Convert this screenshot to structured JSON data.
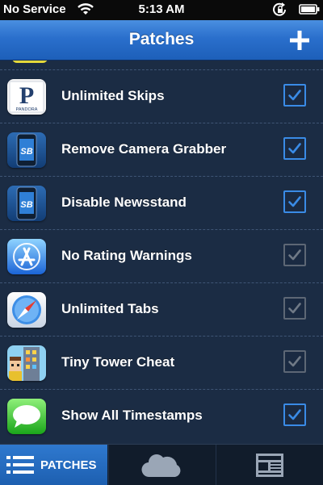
{
  "status_bar": {
    "carrier": "No Service",
    "time": "5:13 AM"
  },
  "nav": {
    "title": "Patches",
    "add_icon": "plus-icon"
  },
  "patches": [
    {
      "label": "Unlimited Skips",
      "icon": "pandora-app-icon",
      "icon_text": "P",
      "icon_subtext": "PANDORA",
      "checked": true
    },
    {
      "label": "Remove Camera Grabber",
      "icon": "springboard-app-icon",
      "icon_text": "SB",
      "checked": true
    },
    {
      "label": "Disable Newsstand",
      "icon": "springboard-app-icon",
      "icon_text": "SB",
      "checked": true
    },
    {
      "label": "No Rating Warnings",
      "icon": "app-store-icon",
      "checked": false
    },
    {
      "label": "Unlimited Tabs",
      "icon": "safari-icon",
      "checked": false
    },
    {
      "label": "Tiny Tower Cheat",
      "icon": "tiny-tower-icon",
      "checked": false
    },
    {
      "label": "Show All Timestamps",
      "icon": "messages-icon",
      "checked": true
    }
  ],
  "tab_bar": {
    "patches_label": "PATCHES",
    "active_tab": "patches",
    "tabs": [
      "patches",
      "cloud",
      "news"
    ]
  },
  "colors": {
    "background": "#1b2c44",
    "nav_blue": "#2a6fcc",
    "check_on": "#3a8be6",
    "check_off": "#5d6775"
  }
}
